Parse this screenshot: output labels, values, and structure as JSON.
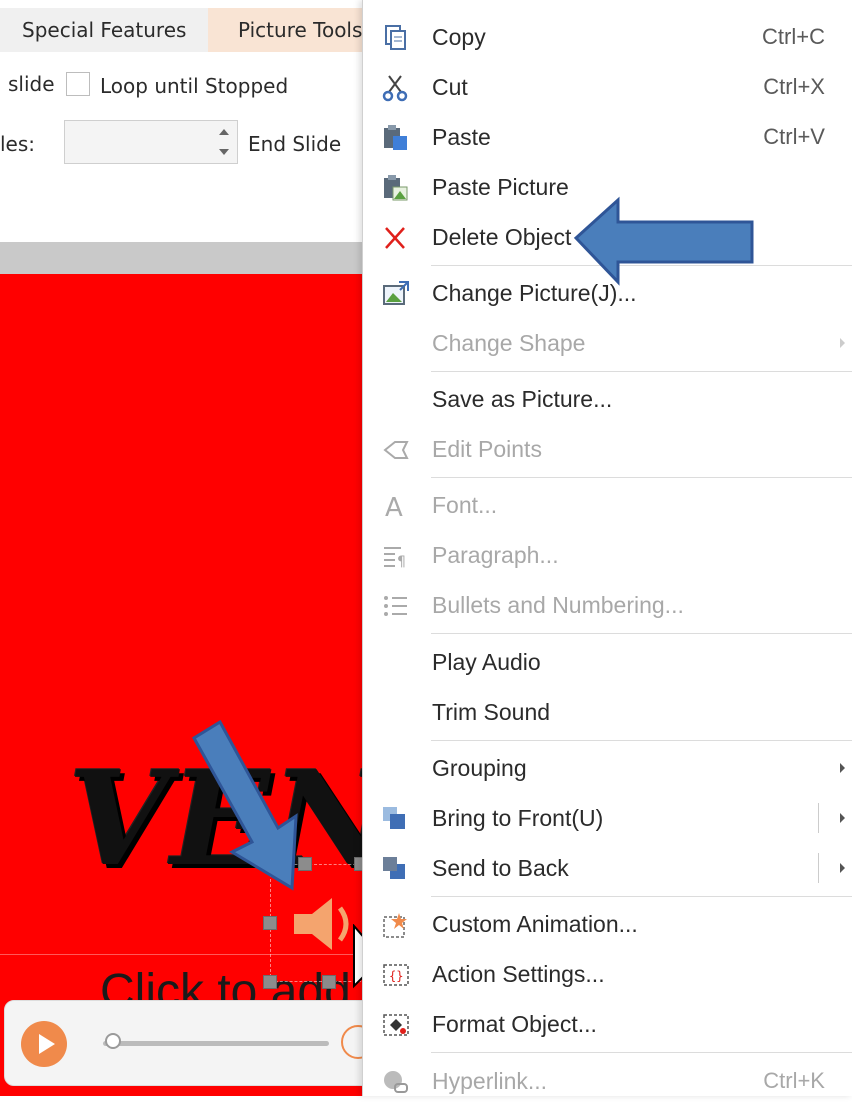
{
  "ribbon": {
    "tabs": [
      "Special Features",
      "Picture Tools"
    ],
    "slide_label": "slide",
    "loop_label": "Loop until Stopped",
    "slides_label": "les:",
    "spinner_value": "",
    "end_slide_label": "End Slide"
  },
  "slide": {
    "title_text": "VEN",
    "subtitle_placeholder": "Click to add"
  },
  "context_menu": {
    "items": [
      {
        "label": "Copy",
        "shortcut": "Ctrl+C",
        "icon": "copy-icon",
        "enabled": true
      },
      {
        "label": "Cut",
        "shortcut": "Ctrl+X",
        "icon": "scissors-icon",
        "enabled": true
      },
      {
        "label": "Paste",
        "shortcut": "Ctrl+V",
        "icon": "paste-icon",
        "enabled": true
      },
      {
        "label": "Paste Picture",
        "shortcut": "",
        "icon": "paste-picture-icon",
        "enabled": true
      },
      {
        "label": "Delete Object",
        "shortcut": "",
        "icon": "delete-x-icon",
        "enabled": true
      },
      {
        "label": "Change Picture(J)...",
        "shortcut": "",
        "icon": "change-picture-icon",
        "enabled": true
      },
      {
        "label": "Change Shape",
        "shortcut": "",
        "icon": "",
        "enabled": false
      },
      {
        "label": "Save as Picture...",
        "shortcut": "",
        "icon": "",
        "enabled": true
      },
      {
        "label": "Edit Points",
        "shortcut": "",
        "icon": "edit-points-icon",
        "enabled": false
      },
      {
        "label": "Font...",
        "shortcut": "",
        "icon": "font-icon",
        "enabled": false
      },
      {
        "label": "Paragraph...",
        "shortcut": "",
        "icon": "paragraph-icon",
        "enabled": false
      },
      {
        "label": "Bullets and Numbering...",
        "shortcut": "",
        "icon": "bullets-icon",
        "enabled": false
      },
      {
        "label": "Play Audio",
        "shortcut": "",
        "icon": "",
        "enabled": true
      },
      {
        "label": "Trim Sound",
        "shortcut": "",
        "icon": "",
        "enabled": true
      },
      {
        "label": "Grouping",
        "shortcut": "",
        "icon": "",
        "enabled": true
      },
      {
        "label": "Bring to Front(U)",
        "shortcut": "",
        "icon": "bring-to-front-icon",
        "enabled": true
      },
      {
        "label": "Send to Back",
        "shortcut": "",
        "icon": "send-to-back-icon",
        "enabled": true
      },
      {
        "label": "Custom Animation...",
        "shortcut": "",
        "icon": "custom-animation-icon",
        "enabled": true
      },
      {
        "label": "Action Settings...",
        "shortcut": "",
        "icon": "action-settings-icon",
        "enabled": true
      },
      {
        "label": "Format Object...",
        "shortcut": "",
        "icon": "format-object-icon",
        "enabled": true
      },
      {
        "label": "Hyperlink...",
        "shortcut": "Ctrl+K",
        "icon": "hyperlink-icon",
        "enabled": false
      }
    ]
  },
  "colors": {
    "slide_background": "#ff0000",
    "annotation_arrow": "#4a7ebb",
    "accent_orange": "#f08a4b",
    "delete_red": "#e0201b"
  }
}
